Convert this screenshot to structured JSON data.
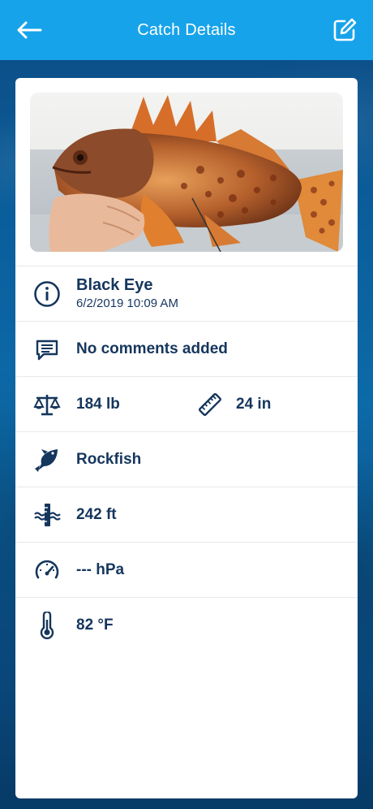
{
  "header": {
    "title": "Catch Details",
    "back_icon": "arrow-left-icon",
    "edit_icon": "edit-icon",
    "color": "#17a3ea"
  },
  "catch": {
    "name": "Black Eye",
    "datetime": "6/2/2019 10:09 AM",
    "comments": "No comments added",
    "weight": "184 lb",
    "length": "24 in",
    "species": "Rockfish",
    "depth": "242 ft",
    "pressure": "--- hPa",
    "temperature": "82 °F"
  },
  "icons": {
    "info": "info-icon",
    "comment": "comment-icon",
    "weight": "scale-icon",
    "length": "ruler-icon",
    "species": "fish-icon",
    "depth": "depth-icon",
    "pressure": "gauge-icon",
    "temperature": "thermometer-icon"
  },
  "colors": {
    "text": "#15365d",
    "divider": "#e6e9ed"
  }
}
